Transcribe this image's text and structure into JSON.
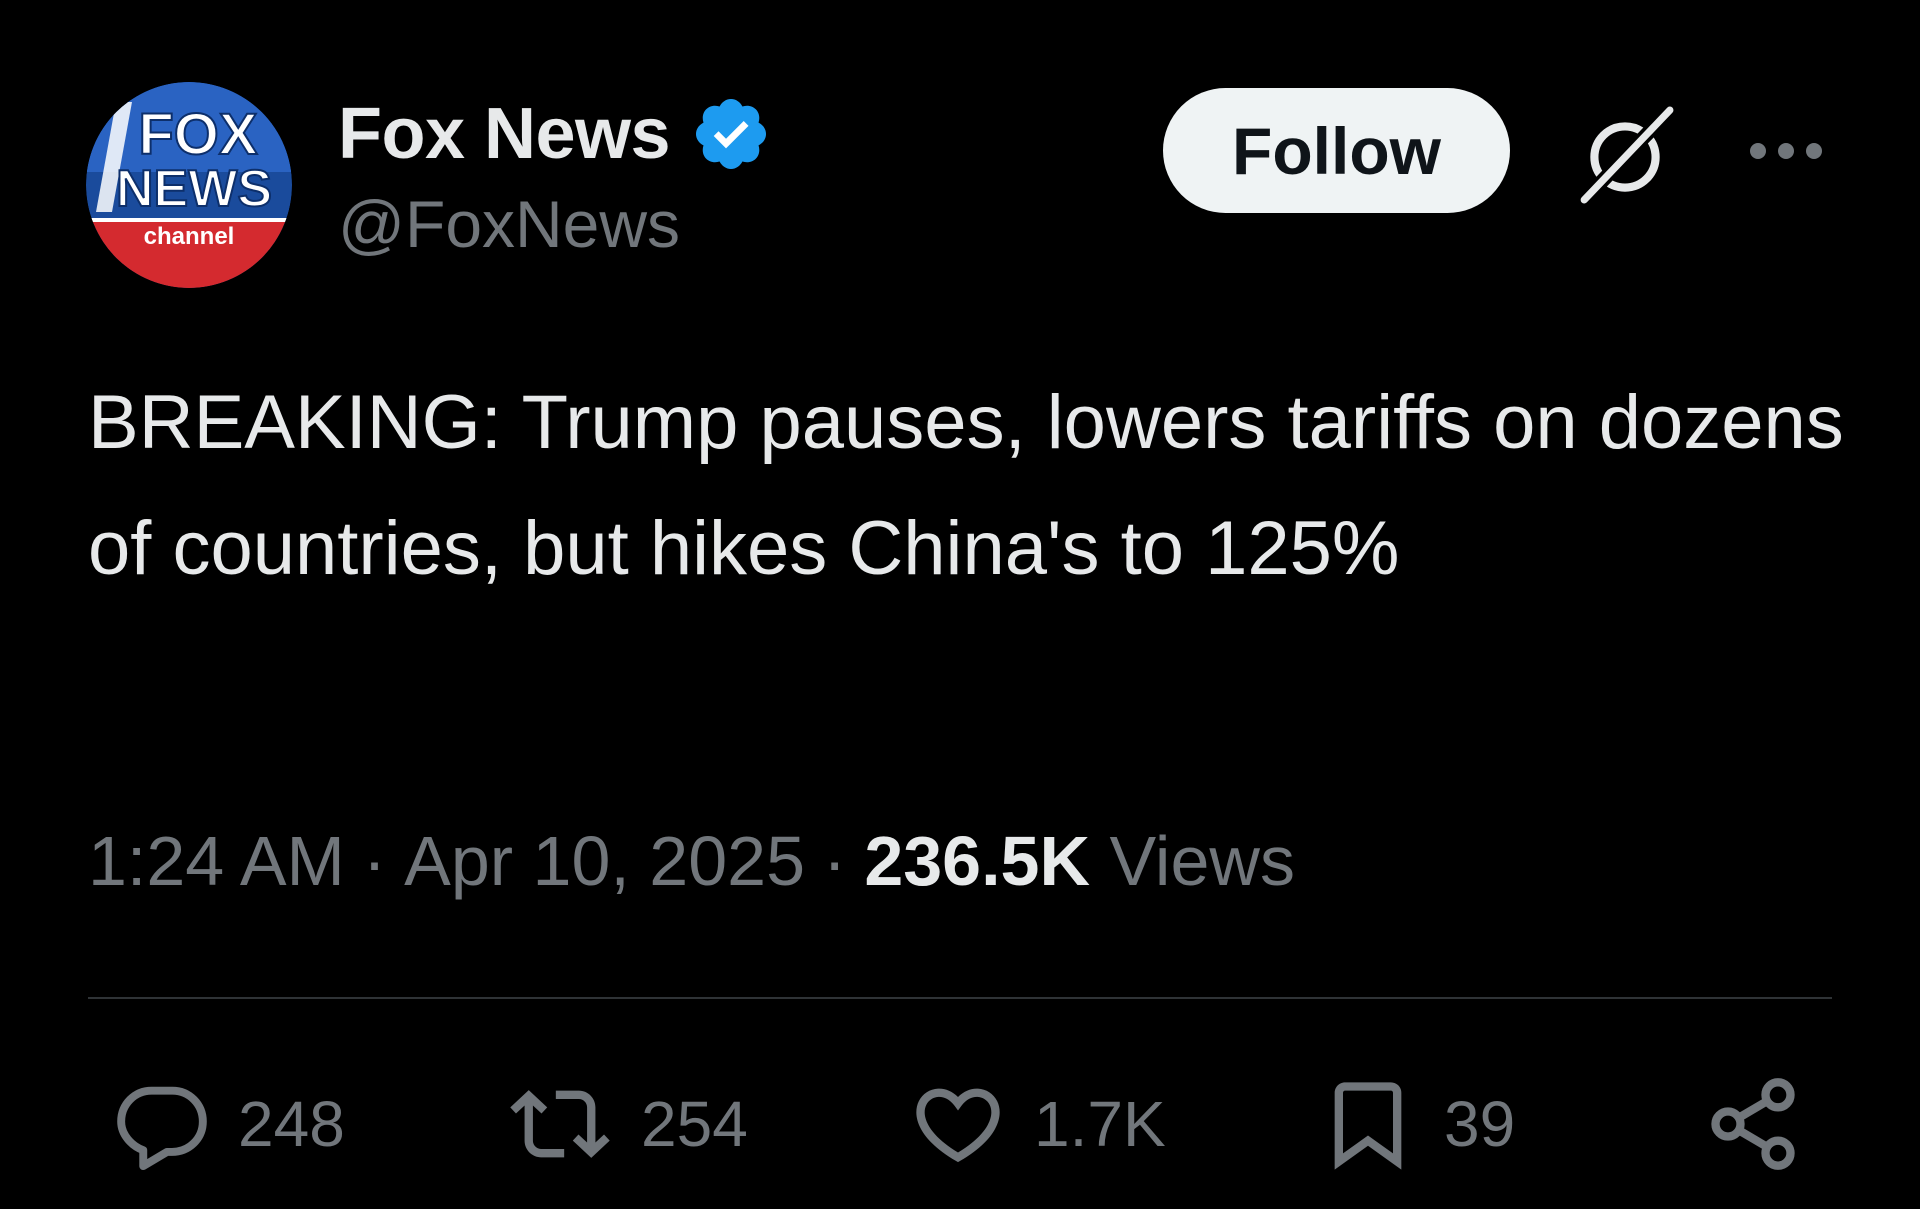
{
  "author": {
    "display_name": "Fox News",
    "handle": "@FoxNews",
    "verified": true,
    "avatar_text": {
      "line1": "FOX",
      "line2": "NEWS",
      "line3": "channel"
    }
  },
  "header": {
    "follow_label": "Follow",
    "icons": [
      "grok-icon",
      "more-icon"
    ]
  },
  "tweet": {
    "text": "BREAKING: Trump pauses, lowers tariffs on dozens of countries, but hikes China's to 125%"
  },
  "meta": {
    "time": "1:24 AM",
    "separator": "·",
    "date": "Apr 10, 2025",
    "views_count": "236.5K",
    "views_label": "Views"
  },
  "actions": {
    "replies": "248",
    "reposts": "254",
    "likes": "1.7K",
    "bookmarks": "39"
  },
  "colors": {
    "background": "#000000",
    "primary_text": "#e7e9ea",
    "secondary_text": "#71767b",
    "divider": "#2f3336",
    "verified_blue": "#1d9bf0",
    "follow_bg": "#eff3f4",
    "fox_blue": "#1a4b9c",
    "fox_red": "#d42a2f"
  }
}
